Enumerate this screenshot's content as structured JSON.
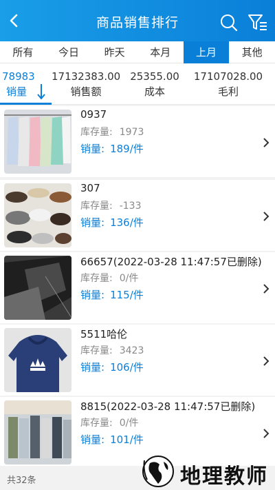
{
  "header": {
    "title": "商品销售排行",
    "back_icon": "back-chevron-icon",
    "search_icon": "search-icon",
    "filter_icon": "filter-icon"
  },
  "tabs": [
    {
      "label": "所有"
    },
    {
      "label": "今日"
    },
    {
      "label": "昨天"
    },
    {
      "label": "本月"
    },
    {
      "label": "上月",
      "active": true
    },
    {
      "label": "其他"
    }
  ],
  "stats": [
    {
      "value": "78983",
      "label": "销量",
      "active": true
    },
    {
      "value": "17132383.00",
      "label": "销售额"
    },
    {
      "value": "25355.00",
      "label": "成本"
    },
    {
      "value": "17107028.00",
      "label": "毛利"
    }
  ],
  "items": [
    {
      "name": "0937",
      "stock_label": "库存量:",
      "stock": "1973",
      "sales_label": "销量:",
      "sales": "189/件"
    },
    {
      "name": "307",
      "stock_label": "库存量:",
      "stock": "-133",
      "sales_label": "销量:",
      "sales": "136/件"
    },
    {
      "name": "66657(2022-03-28 11:47:57已删除)",
      "stock_label": "库存量:",
      "stock": "0/件",
      "sales_label": "销量:",
      "sales": "115/件"
    },
    {
      "name": "5511哈伦",
      "stock_label": "库存量:",
      "stock": "3423",
      "sales_label": "销量:",
      "sales": "106/件"
    },
    {
      "name": "8815(2022-03-28 11:47:57已删除)",
      "stock_label": "库存量:",
      "stock": "0/件",
      "sales_label": "销量:",
      "sales": "101/件"
    }
  ],
  "footer": {
    "count": "共32条"
  },
  "watermark": {
    "text": "地理教师"
  },
  "colors": {
    "accent": "#0a7fd8",
    "header": "#1a9ee8"
  }
}
